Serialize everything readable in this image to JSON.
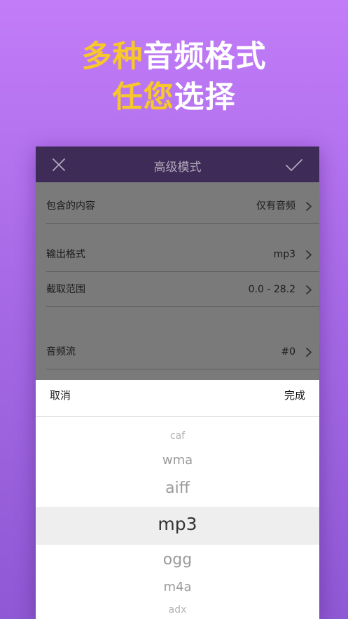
{
  "hero": {
    "line1_highlight": "多种",
    "line1_rest": "音频格式",
    "line2_highlight": "任您",
    "line2_rest": "选择",
    "highlight_color": "#f7c72b"
  },
  "navbar": {
    "title": "高级模式",
    "close_icon": "close-icon",
    "confirm_icon": "checkmark-icon"
  },
  "settings": {
    "rows": [
      {
        "label": "包含的内容",
        "value": "仅有音频"
      },
      {
        "label": "输出格式",
        "value": "mp3"
      },
      {
        "label": "截取范围",
        "value": "0.0 - 28.2"
      },
      {
        "label": "音频流",
        "value": "#0"
      }
    ]
  },
  "picker": {
    "cancel_label": "取消",
    "done_label": "完成",
    "options": [
      "caf",
      "wma",
      "aiff",
      "mp3",
      "ogg",
      "m4a",
      "adx"
    ],
    "selected": "mp3"
  }
}
